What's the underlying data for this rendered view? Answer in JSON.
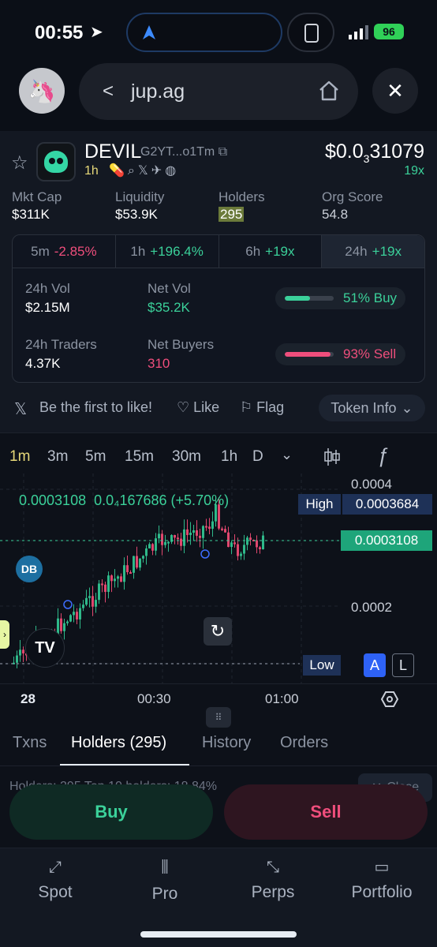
{
  "status_bar": {
    "time": "00:55",
    "battery": "96"
  },
  "browser": {
    "back_glyph": "<",
    "url": "jup.ag",
    "close_glyph": "✕"
  },
  "token": {
    "name": "DEVIL",
    "address": "G2YT...o1Tm",
    "age": "1h",
    "price_prefix": "$0.0",
    "price_sub": "3",
    "price_suffix": "31079",
    "change": "19x"
  },
  "stats": [
    {
      "label": "Mkt Cap",
      "value": "$311K"
    },
    {
      "label": "Liquidity",
      "value": "$53.9K"
    },
    {
      "label": "Holders",
      "value": "295"
    },
    {
      "label": "Org Score",
      "value": "54.8"
    }
  ],
  "timeframes": [
    {
      "label": "5m",
      "change": "-2.85%",
      "tone": "neg"
    },
    {
      "label": "1h",
      "change": "+196.4%",
      "tone": "pos"
    },
    {
      "label": "6h",
      "change": "+19x",
      "tone": "pos"
    },
    {
      "label": "24h",
      "change": "+19x",
      "tone": "pos"
    }
  ],
  "volume": {
    "vol_label": "24h Vol",
    "vol_value": "$2.15M",
    "netvol_label": "Net Vol",
    "netvol_value": "$35.2K",
    "buy_pct_text": "51% Buy",
    "buy_fraction": 0.51,
    "traders_label": "24h Traders",
    "traders_value": "4.37K",
    "netbuyers_label": "Net Buyers",
    "netbuyers_value": "310",
    "sell_pct_text": "93% Sell",
    "sell_fraction": 0.93
  },
  "social": {
    "be_first": "Be the first to like!",
    "like": "Like",
    "flag": "Flag",
    "token_info": "Token Info"
  },
  "chart": {
    "intervals": [
      "1m",
      "3m",
      "5m",
      "15m",
      "30m",
      "1h",
      "D"
    ],
    "active_interval": "1m",
    "legend_price": "0.0003108",
    "legend_change": "0.0₄167686 (+5.70%)",
    "top_tick": "0.0004",
    "high_label": "High",
    "high_value": "0.0003684",
    "last_value": "0.0003108",
    "mid_tick": "0.0002",
    "low_label": "Low",
    "a_label": "A",
    "l_label": "L",
    "marker": "DB",
    "time_labels": [
      "28",
      "00:30",
      "01:00"
    ]
  },
  "tabs": {
    "txns": "Txns",
    "holders": "Holders (295)",
    "history": "History",
    "orders": "Orders"
  },
  "holders_line": "Holders: 295   Top 10 holders: 18.84%",
  "close_chip": "Close",
  "actions": {
    "buy": "Buy",
    "sell": "Sell"
  },
  "nav": [
    {
      "label": "Spot",
      "icon": "spot-icon"
    },
    {
      "label": "Pro",
      "icon": "pro-icon"
    },
    {
      "label": "Perps",
      "icon": "perps-icon"
    },
    {
      "label": "Portfolio",
      "icon": "portfolio-icon"
    }
  ],
  "colors": {
    "buy": "#3bd19a",
    "sell": "#ef4e7c",
    "accent": "#e6d879"
  }
}
